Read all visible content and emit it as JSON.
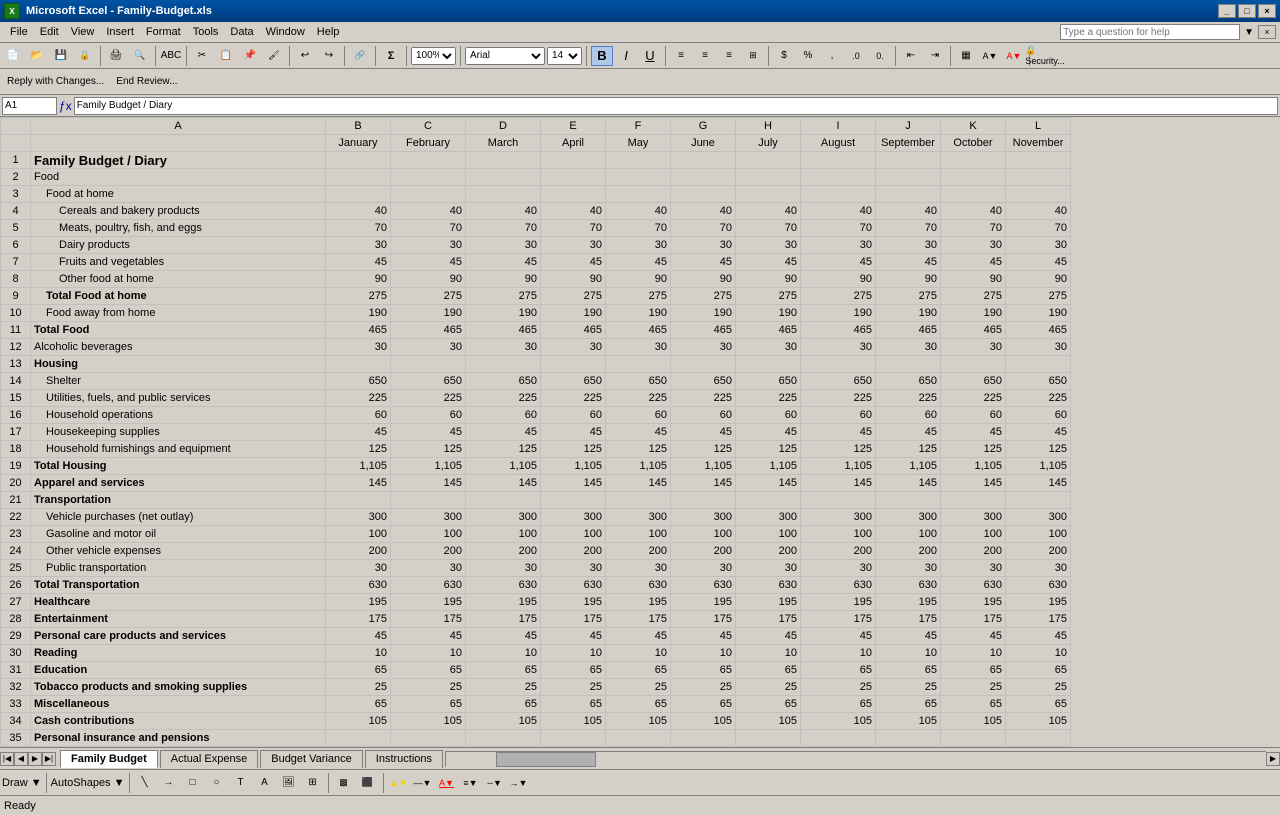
{
  "titleBar": {
    "icon": "X",
    "title": "Microsoft Excel - Family-Budget.xls",
    "buttons": [
      "_",
      "□",
      "×"
    ]
  },
  "menuBar": {
    "items": [
      "File",
      "Edit",
      "View",
      "Insert",
      "Format",
      "Tools",
      "Data",
      "Window",
      "Help"
    ]
  },
  "helpBar": {
    "placeholder": "Type a question for help"
  },
  "toolbar1": {
    "zoom": "100%",
    "fontName": "Arial",
    "fontSize": "14"
  },
  "formulaBar": {
    "cellRef": "A1",
    "formula": "Family Budget / Diary"
  },
  "spreadsheet": {
    "columns": [
      "",
      "A",
      "B",
      "C",
      "D",
      "E",
      "F",
      "G",
      "H",
      "I",
      "J",
      "K",
      "L"
    ],
    "colHeaders": [
      "",
      "",
      "January",
      "February",
      "March",
      "April",
      "May",
      "June",
      "July",
      "August",
      "September",
      "October",
      "November"
    ],
    "rows": [
      {
        "row": "1",
        "cells": [
          "Family Budget / Diary",
          "",
          "",
          "",
          "",
          "",
          "",
          "",
          "",
          "",
          "",
          ""
        ],
        "style": "bold"
      },
      {
        "row": "2",
        "cells": [
          "Food",
          "",
          "",
          "",
          "",
          "",
          "",
          "",
          "",
          "",
          "",
          ""
        ],
        "style": ""
      },
      {
        "row": "3",
        "cells": [
          "Food at home",
          "",
          "",
          "",
          "",
          "",
          "",
          "",
          "",
          "",
          "",
          ""
        ],
        "style": "indent1"
      },
      {
        "row": "4",
        "cells": [
          "Cereals and bakery products",
          "40",
          "40",
          "40",
          "40",
          "40",
          "40",
          "40",
          "40",
          "40",
          "40",
          "40"
        ],
        "style": "indent2"
      },
      {
        "row": "5",
        "cells": [
          "Meats, poultry, fish, and eggs",
          "70",
          "70",
          "70",
          "70",
          "70",
          "70",
          "70",
          "70",
          "70",
          "70",
          "70"
        ],
        "style": "indent2"
      },
      {
        "row": "6",
        "cells": [
          "Dairy products",
          "30",
          "30",
          "30",
          "30",
          "30",
          "30",
          "30",
          "30",
          "30",
          "30",
          "30"
        ],
        "style": "indent2"
      },
      {
        "row": "7",
        "cells": [
          "Fruits and vegetables",
          "45",
          "45",
          "45",
          "45",
          "45",
          "45",
          "45",
          "45",
          "45",
          "45",
          "45"
        ],
        "style": "indent2"
      },
      {
        "row": "8",
        "cells": [
          "Other food at home",
          "90",
          "90",
          "90",
          "90",
          "90",
          "90",
          "90",
          "90",
          "90",
          "90",
          "90"
        ],
        "style": "indent2"
      },
      {
        "row": "9",
        "cells": [
          "Total Food at home",
          "275",
          "275",
          "275",
          "275",
          "275",
          "275",
          "275",
          "275",
          "275",
          "275",
          "275"
        ],
        "style": "bold indent1"
      },
      {
        "row": "10",
        "cells": [
          "Food away from home",
          "190",
          "190",
          "190",
          "190",
          "190",
          "190",
          "190",
          "190",
          "190",
          "190",
          "190"
        ],
        "style": "indent1"
      },
      {
        "row": "11",
        "cells": [
          "Total Food",
          "465",
          "465",
          "465",
          "465",
          "465",
          "465",
          "465",
          "465",
          "465",
          "465",
          "465"
        ],
        "style": "bold"
      },
      {
        "row": "12",
        "cells": [
          "Alcoholic beverages",
          "30",
          "30",
          "30",
          "30",
          "30",
          "30",
          "30",
          "30",
          "30",
          "30",
          "30"
        ],
        "style": ""
      },
      {
        "row": "13",
        "cells": [
          "Housing",
          "",
          "",
          "",
          "",
          "",
          "",
          "",
          "",
          "",
          "",
          ""
        ],
        "style": "bold"
      },
      {
        "row": "14",
        "cells": [
          "Shelter",
          "650",
          "650",
          "650",
          "650",
          "650",
          "650",
          "650",
          "650",
          "650",
          "650",
          "650"
        ],
        "style": "indent1"
      },
      {
        "row": "15",
        "cells": [
          "Utilities, fuels, and public services",
          "225",
          "225",
          "225",
          "225",
          "225",
          "225",
          "225",
          "225",
          "225",
          "225",
          "225"
        ],
        "style": "indent1"
      },
      {
        "row": "16",
        "cells": [
          "Household operations",
          "60",
          "60",
          "60",
          "60",
          "60",
          "60",
          "60",
          "60",
          "60",
          "60",
          "60"
        ],
        "style": "indent1"
      },
      {
        "row": "17",
        "cells": [
          "Housekeeping supplies",
          "45",
          "45",
          "45",
          "45",
          "45",
          "45",
          "45",
          "45",
          "45",
          "45",
          "45"
        ],
        "style": "indent1"
      },
      {
        "row": "18",
        "cells": [
          "Household furnishings and equipment",
          "125",
          "125",
          "125",
          "125",
          "125",
          "125",
          "125",
          "125",
          "125",
          "125",
          "125"
        ],
        "style": "indent1"
      },
      {
        "row": "19",
        "cells": [
          "Total Housing",
          "1,105",
          "1,105",
          "1,105",
          "1,105",
          "1,105",
          "1,105",
          "1,105",
          "1,105",
          "1,105",
          "1,105",
          "1,105"
        ],
        "style": "bold"
      },
      {
        "row": "20",
        "cells": [
          "Apparel and services",
          "145",
          "145",
          "145",
          "145",
          "145",
          "145",
          "145",
          "145",
          "145",
          "145",
          "145"
        ],
        "style": "bold"
      },
      {
        "row": "21",
        "cells": [
          "Transportation",
          "",
          "",
          "",
          "",
          "",
          "",
          "",
          "",
          "",
          "",
          ""
        ],
        "style": "bold"
      },
      {
        "row": "22",
        "cells": [
          "Vehicle purchases (net outlay)",
          "300",
          "300",
          "300",
          "300",
          "300",
          "300",
          "300",
          "300",
          "300",
          "300",
          "300"
        ],
        "style": "indent1"
      },
      {
        "row": "23",
        "cells": [
          "Gasoline and motor oil",
          "100",
          "100",
          "100",
          "100",
          "100",
          "100",
          "100",
          "100",
          "100",
          "100",
          "100"
        ],
        "style": "indent1"
      },
      {
        "row": "24",
        "cells": [
          "Other vehicle expenses",
          "200",
          "200",
          "200",
          "200",
          "200",
          "200",
          "200",
          "200",
          "200",
          "200",
          "200"
        ],
        "style": "indent1"
      },
      {
        "row": "25",
        "cells": [
          "Public transportation",
          "30",
          "30",
          "30",
          "30",
          "30",
          "30",
          "30",
          "30",
          "30",
          "30",
          "30"
        ],
        "style": "indent1"
      },
      {
        "row": "26",
        "cells": [
          "Total Transportation",
          "630",
          "630",
          "630",
          "630",
          "630",
          "630",
          "630",
          "630",
          "630",
          "630",
          "630"
        ],
        "style": "bold"
      },
      {
        "row": "27",
        "cells": [
          "Healthcare",
          "195",
          "195",
          "195",
          "195",
          "195",
          "195",
          "195",
          "195",
          "195",
          "195",
          "195"
        ],
        "style": "bold"
      },
      {
        "row": "28",
        "cells": [
          "Entertainment",
          "175",
          "175",
          "175",
          "175",
          "175",
          "175",
          "175",
          "175",
          "175",
          "175",
          "175"
        ],
        "style": "bold"
      },
      {
        "row": "29",
        "cells": [
          "Personal care products and services",
          "45",
          "45",
          "45",
          "45",
          "45",
          "45",
          "45",
          "45",
          "45",
          "45",
          "45"
        ],
        "style": "bold"
      },
      {
        "row": "30",
        "cells": [
          "Reading",
          "10",
          "10",
          "10",
          "10",
          "10",
          "10",
          "10",
          "10",
          "10",
          "10",
          "10"
        ],
        "style": "bold"
      },
      {
        "row": "31",
        "cells": [
          "Education",
          "65",
          "65",
          "65",
          "65",
          "65",
          "65",
          "65",
          "65",
          "65",
          "65",
          "65"
        ],
        "style": "bold"
      },
      {
        "row": "32",
        "cells": [
          "Tobacco products and smoking supplies",
          "25",
          "25",
          "25",
          "25",
          "25",
          "25",
          "25",
          "25",
          "25",
          "25",
          "25"
        ],
        "style": "bold"
      },
      {
        "row": "33",
        "cells": [
          "Miscellaneous",
          "65",
          "65",
          "65",
          "65",
          "65",
          "65",
          "65",
          "65",
          "65",
          "65",
          "65"
        ],
        "style": "bold"
      },
      {
        "row": "34",
        "cells": [
          "Cash contributions",
          "105",
          "105",
          "105",
          "105",
          "105",
          "105",
          "105",
          "105",
          "105",
          "105",
          "105"
        ],
        "style": "bold"
      },
      {
        "row": "35",
        "cells": [
          "Personal insurance and pensions",
          "",
          "",
          "",
          "",
          "",
          "",
          "",
          "",
          "",
          "",
          ""
        ],
        "style": "bold"
      }
    ]
  },
  "sheetTabs": {
    "tabs": [
      "Family Budget",
      "Actual Expense",
      "Budget Variance",
      "Instructions"
    ],
    "active": "Family Budget"
  },
  "statusBar": {
    "text": "Ready"
  },
  "drawToolbar": {
    "draw": "Draw ▼",
    "autoshapes": "AutoShapes ▼"
  }
}
